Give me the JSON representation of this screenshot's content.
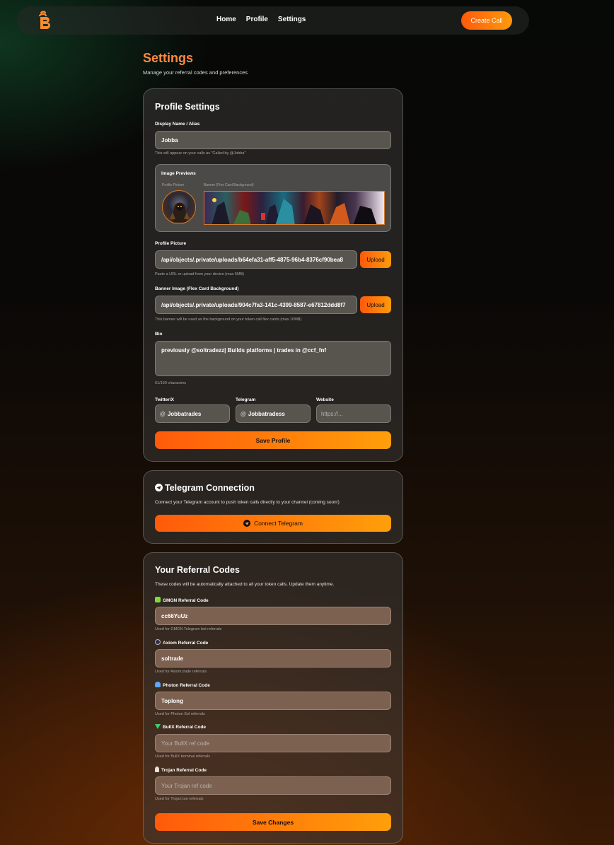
{
  "nav": {
    "links": [
      "Home",
      "Profile",
      "Settings"
    ],
    "create_label": "Create Call"
  },
  "page": {
    "title": "Settings",
    "subtitle": "Manage your referral codes and preferences"
  },
  "profile": {
    "title": "Profile Settings",
    "display_name_label": "Display Name / Alias",
    "display_name_value": "Jobba",
    "display_name_help": "This will appear on your calls as \"Called by @Jobba\"",
    "previews_title": "Image Previews",
    "profile_pic_preview_label": "Profile Picture",
    "banner_preview_label": "Banner (Flex Card Background)",
    "profile_pic_label": "Profile Picture",
    "profile_pic_value": "/api/objects/.private/uploads/b64efa31-aff5-4875-96b4-8376cf90bea8",
    "profile_pic_help": "Paste a URL or upload from your device (max 5MB)",
    "banner_label": "Banner Image (Flex Card Background)",
    "banner_value": "/api/objects/.private/uploads/904c7fa3-141c-4399-8587-e67812ddd8f7",
    "banner_help": "This banner will be used as the background on your token call flex cards (max 10MB)",
    "upload_label": "Upload",
    "bio_label": "Bio",
    "bio_value": "previously @soltradezz| Builds platforms | trades in @ccf_fnf",
    "bio_count": "61/160 characters",
    "twitter_label": "Twitter/X",
    "twitter_value": "Jobbatrades",
    "telegram_label": "Telegram",
    "telegram_value": "Jobbatradess",
    "website_label": "Website",
    "website_placeholder": "https://...",
    "at_symbol": "@",
    "save_label": "Save Profile"
  },
  "telegram": {
    "title": "Telegram Connection",
    "description": "Connect your Telegram account to push token calls directly to your channel (coming soon!)",
    "connect_label": "Connect Telegram"
  },
  "referral": {
    "title": "Your Referral Codes",
    "description": "These codes will be automatically attached to all your token calls. Update them anytime.",
    "codes": [
      {
        "label": "GMGN Referral Code",
        "value": "cc66YuUz",
        "placeholder": "",
        "help": "Used for GMGN Telegram bot referrals",
        "icon": "gmgn-icon",
        "color": "#7ddc3c"
      },
      {
        "label": "Axiom Referral Code",
        "value": "soltrade",
        "placeholder": "",
        "help": "Used for Axiom.trade referrals",
        "icon": "axiom-icon",
        "color": "#2a2e4a"
      },
      {
        "label": "Photon Referral Code",
        "value": "Toplong",
        "placeholder": "",
        "help": "Used for Photon Sol referrals",
        "icon": "photon-icon",
        "color": "#5aa8ff"
      },
      {
        "label": "BullX Referral Code",
        "value": "",
        "placeholder": "Your BullX ref code",
        "help": "Used for BullX terminal referrals",
        "icon": "bullx-icon",
        "color": "#3ccf6a"
      },
      {
        "label": "Trojan Referral Code",
        "value": "",
        "placeholder": "Your Trojan ref code",
        "help": "Used for Trojan bot referrals",
        "icon": "trojan-icon",
        "color": "#e8e2d6"
      }
    ],
    "save_label": "Save Changes"
  },
  "colors": {
    "accent_start": "#ff5a0a",
    "accent_end": "#ff9f0a",
    "title_orange": "#ff8a3d"
  }
}
